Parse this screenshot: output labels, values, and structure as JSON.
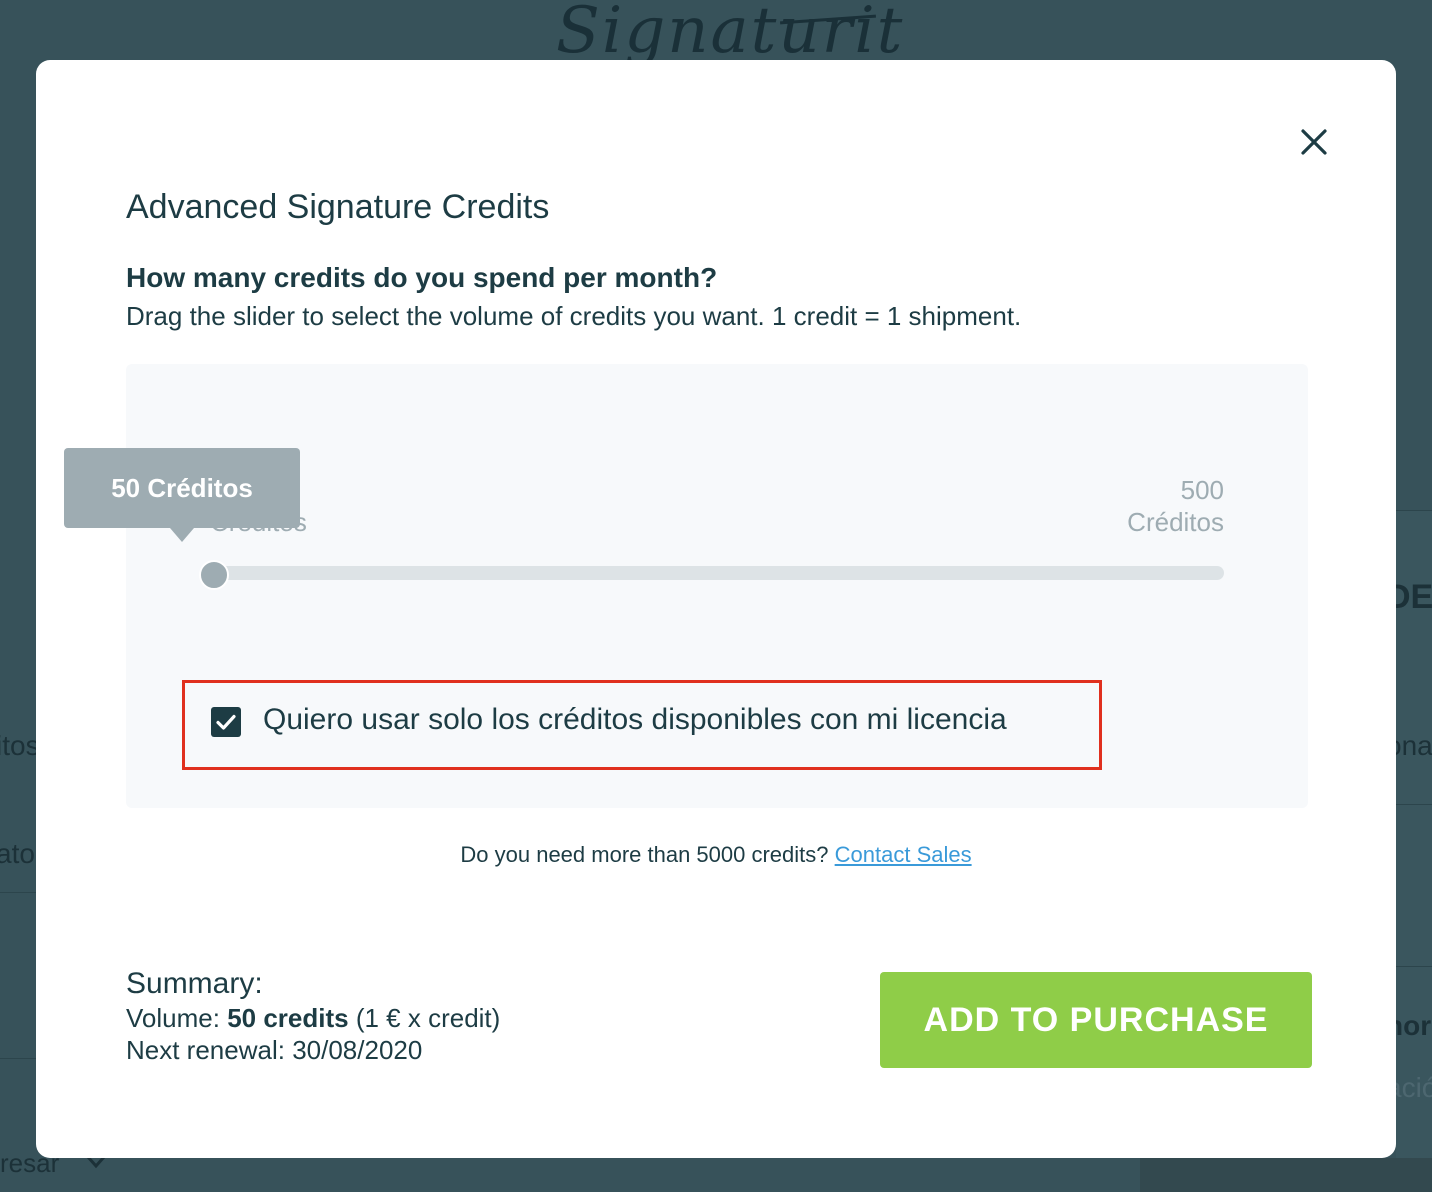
{
  "background": {
    "logo": "Signaturit",
    "left_texts": [
      "itos",
      "ato"
    ],
    "right_texts": [
      "DE",
      "ona",
      "hor",
      "ació"
    ],
    "bottom_text": "resar"
  },
  "modal": {
    "title": "Advanced Signature Credits",
    "question": "How many credits do you spend per month?",
    "instructions": "Drag the slider to select the volume of credits you want. 1 credit = 1 shipment.",
    "slider": {
      "min_value": "50",
      "min_unit": "Créditos",
      "max_value": "500",
      "max_unit": "Créditos",
      "tooltip": "50 Créditos",
      "current": 50,
      "min": 50,
      "max": 500
    },
    "checkbox": {
      "label": "Quiero usar solo los créditos disponibles con mi licencia",
      "checked": true
    },
    "more_credits_text": "Do you need more than 5000 credits?",
    "contact_link": "Contact Sales",
    "summary": {
      "title": "Summary:",
      "volume_label": "Volume:",
      "volume_value": "50 credits",
      "volume_price": "(1 € x credit)",
      "renewal_label": "Next renewal:",
      "renewal_date": "30/08/2020"
    },
    "add_button": "ADD TO PURCHASE"
  },
  "colors": {
    "overlay": "#37525a",
    "primary_text": "#1d3c44",
    "slider_grey": "#9eacb2",
    "highlight_border": "#e0301e",
    "button_green": "#8fcd48",
    "link_blue": "#3a9ad9"
  },
  "icons": {
    "close": "close-icon",
    "checkbox": "checkmark-icon",
    "chevron": "chevron-down-icon"
  }
}
